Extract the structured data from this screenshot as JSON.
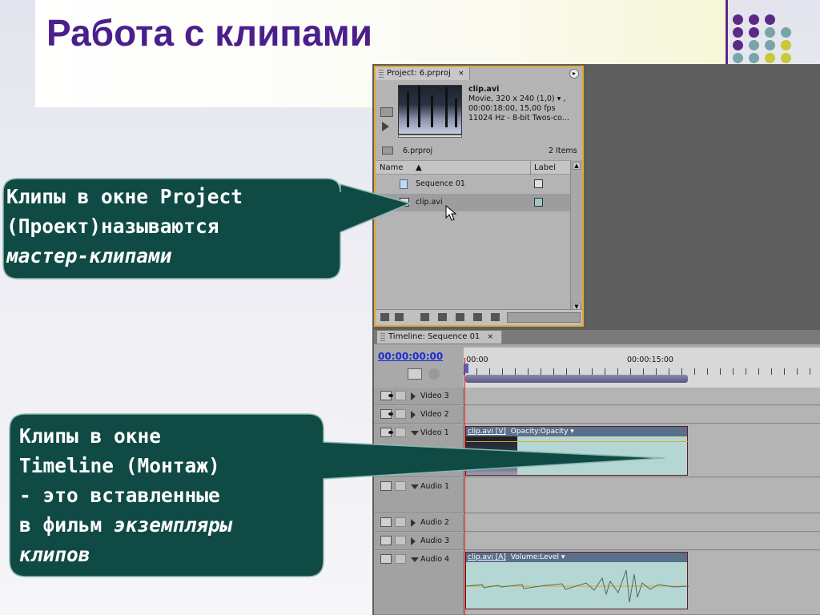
{
  "slide": {
    "title": "Работа с клипами",
    "dot_colors": [
      "#5b2a86",
      "#7aa5a8",
      "#c8c838"
    ]
  },
  "project_panel": {
    "tab_label": "Project: 6.prproj",
    "tab_close": "×",
    "menu_icon": "menu-arrow-icon",
    "clip_name": "clip.avi",
    "clip_info_1": "Movie, 320 x 240 (1,0) ▾ ,",
    "clip_info_2": "00:00:18:00, 15,00 fps",
    "clip_info_3": "11024 Hz - 8-bit Twos-co...",
    "project_name": "6.prproj",
    "items_count": "2 Items",
    "col_name": "Name",
    "col_sort": "▲",
    "col_label": "Label",
    "rows": [
      {
        "name": "Sequence 01",
        "icon": "sequence-icon"
      },
      {
        "name": "clip.avi",
        "icon": "clip-icon"
      }
    ]
  },
  "timeline_panel": {
    "tab_label": "Timeline: Sequence 01",
    "tab_close": "×",
    "timecode": "00:00:00:00",
    "ruler_start": ":00:00",
    "ruler_mid": "00:00:15:00",
    "tracks": [
      {
        "name": "Video 3"
      },
      {
        "name": "Video 2"
      },
      {
        "name": "Video 1"
      },
      {
        "name": "Audio 1"
      },
      {
        "name": "Audio 2"
      },
      {
        "name": "Audio 3"
      },
      {
        "name": "Audio 4"
      }
    ],
    "video_clip_label": "clip.avi [V]",
    "video_clip_effect": "Opacity:Opacity ▾",
    "audio_clip_label": "clip.avi [A]",
    "audio_clip_effect": "Volume:Level ▾"
  },
  "callouts": {
    "project": {
      "line1": "Клипы в окне Project",
      "line2": "(Проект)называются",
      "line3": "мастер-клипами"
    },
    "timeline": {
      "line1": "Клипы в окне",
      "line2": "Timeline (Монтаж)",
      "line3": "- это вставленные",
      "line4_a": "в фильм ",
      "line4_b": "экземпляры",
      "line5": "клипов"
    },
    "bg_color": "#0f4a44"
  }
}
